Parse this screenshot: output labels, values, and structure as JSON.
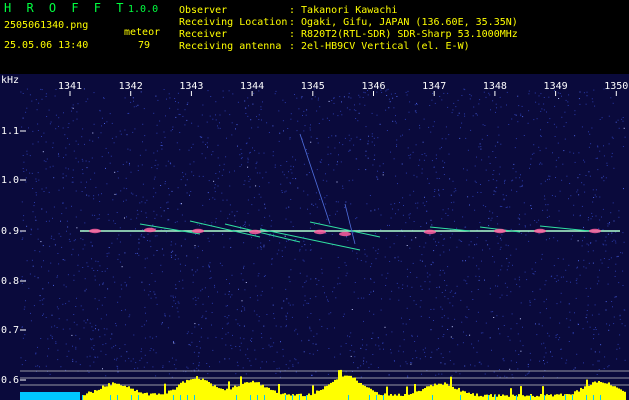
{
  "header": {
    "app_name": "H R O F F T",
    "version": "1.0.0",
    "filename": "2505061340.png",
    "datetime": "25.05.06 13:40",
    "mode_label": "meteor",
    "count": "79",
    "info_keys": [
      "Observer",
      "Receiving Location",
      "Receiver",
      "Receiving antenna"
    ],
    "info_values": [
      ": Takanori Kawachi",
      ": Ogaki, Gifu, JAPAN (136.60E, 35.35N)",
      ": R820T2(RTL-SDR) SDR-Sharp 53.1000MHz",
      ": 2el-HB9CV Vertical (el. E-W)"
    ]
  },
  "spectrogram": {
    "y_unit": "kHz",
    "x_ticks": [
      "1341",
      "1342",
      "1343",
      "1344",
      "1345",
      "1346",
      "1347",
      "1348",
      "1349",
      "1350"
    ],
    "y_ticks": [
      "1.1",
      "1.0",
      "0.9",
      "0.8",
      "0.7",
      "0.6"
    ],
    "colors": {
      "background": "#0a0a3c",
      "noise": "#2a3aa8",
      "trace": "#ffffff",
      "header_green": "#00ff40",
      "header_yellow": "#ffff00",
      "histogram": "#ffff00",
      "cyan_baseline": "#00c8ff"
    }
  }
}
